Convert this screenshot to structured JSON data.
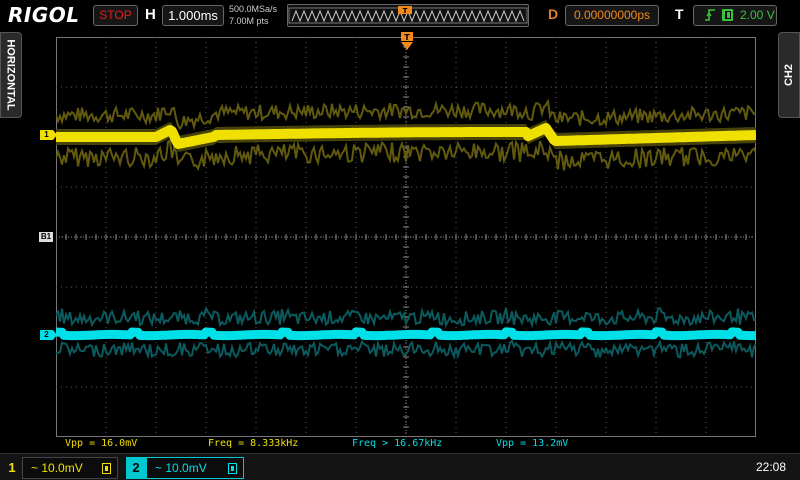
{
  "header": {
    "brand": "RIGOL",
    "run_state": "STOP",
    "h_label": "H",
    "timebase": "1.000ms",
    "sample_rate": "500.0MSa/s",
    "memory_depth": "7.00M pts",
    "d_label": "D",
    "delay": "0.00000000ps",
    "t_label": "T",
    "trigger_level": "2.00 V",
    "trigger_edge_icon": "rising-edge-icon",
    "trigger_source_icon": "dc-coupling-icon"
  },
  "side_tabs": {
    "left": "HORIZONTAL",
    "right": "CH2"
  },
  "markers": {
    "ch1": "1",
    "ch2": "2",
    "b1": "B1"
  },
  "measurements": [
    {
      "label": "Vpp = 16.0mV",
      "color": "#f0e000"
    },
    {
      "label": "Freq = 8.333kHz",
      "color": "#f0e000"
    },
    {
      "label": "Freq > 16.67kHz",
      "color": "#00e0e8"
    },
    {
      "label": "Vpp = 13.2mV",
      "color": "#00e0e8"
    }
  ],
  "channels": [
    {
      "num": "1",
      "scale": "~ 10.0mV",
      "color": "#f0e000"
    },
    {
      "num": "2",
      "scale": "~ 10.0mV",
      "color": "#00e0e8"
    }
  ],
  "clock": "22:08",
  "colors": {
    "ch1": "#f0e000",
    "ch2": "#00e0e8",
    "trigger": "#f08a1c",
    "grid": "#5a5a5a"
  }
}
